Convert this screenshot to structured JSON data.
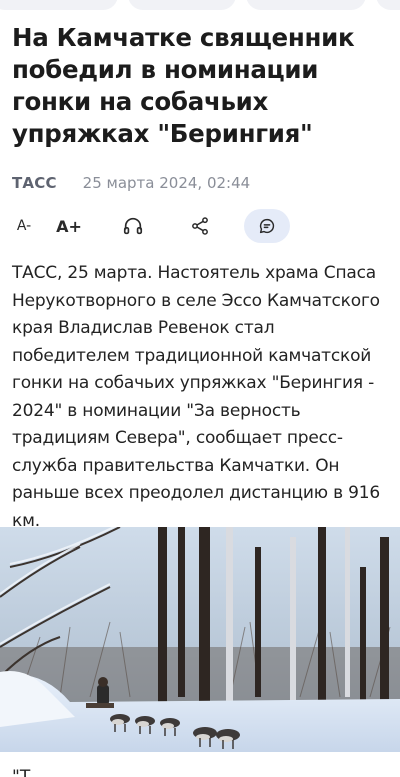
{
  "article": {
    "title": "На Камчатке священник победил в номинации гонки на собачьих упряжках \"Берингия\"",
    "source": "ТАСС",
    "date": "25 марта 2024, 02:44",
    "lead": "ТАСС, 25 марта. Настоятель храма Спаса Нерукотворного в селе Эссо Камчатского края Владислав Ревенок стал победителем традиционной камчатской гонки на собачьих упряжках \"Берингия - 2024\" в номинации \"За верность традициям Севера\", сообщает пресс-служба правительства Камчатки. Он раньше всех преодолел дистанцию в 916 км.",
    "next_paragraph_start": "\"Т"
  },
  "toolbar": {
    "font_decrease_label": "A-",
    "font_increase_label": "A+"
  },
  "icons": {
    "listen": "headphones-icon",
    "share": "share-icon",
    "comments": "comment-icon"
  },
  "colors": {
    "accent_bg": "#e5ebf8",
    "meta_source": "#5e6370",
    "meta_date": "#8a8e98"
  }
}
